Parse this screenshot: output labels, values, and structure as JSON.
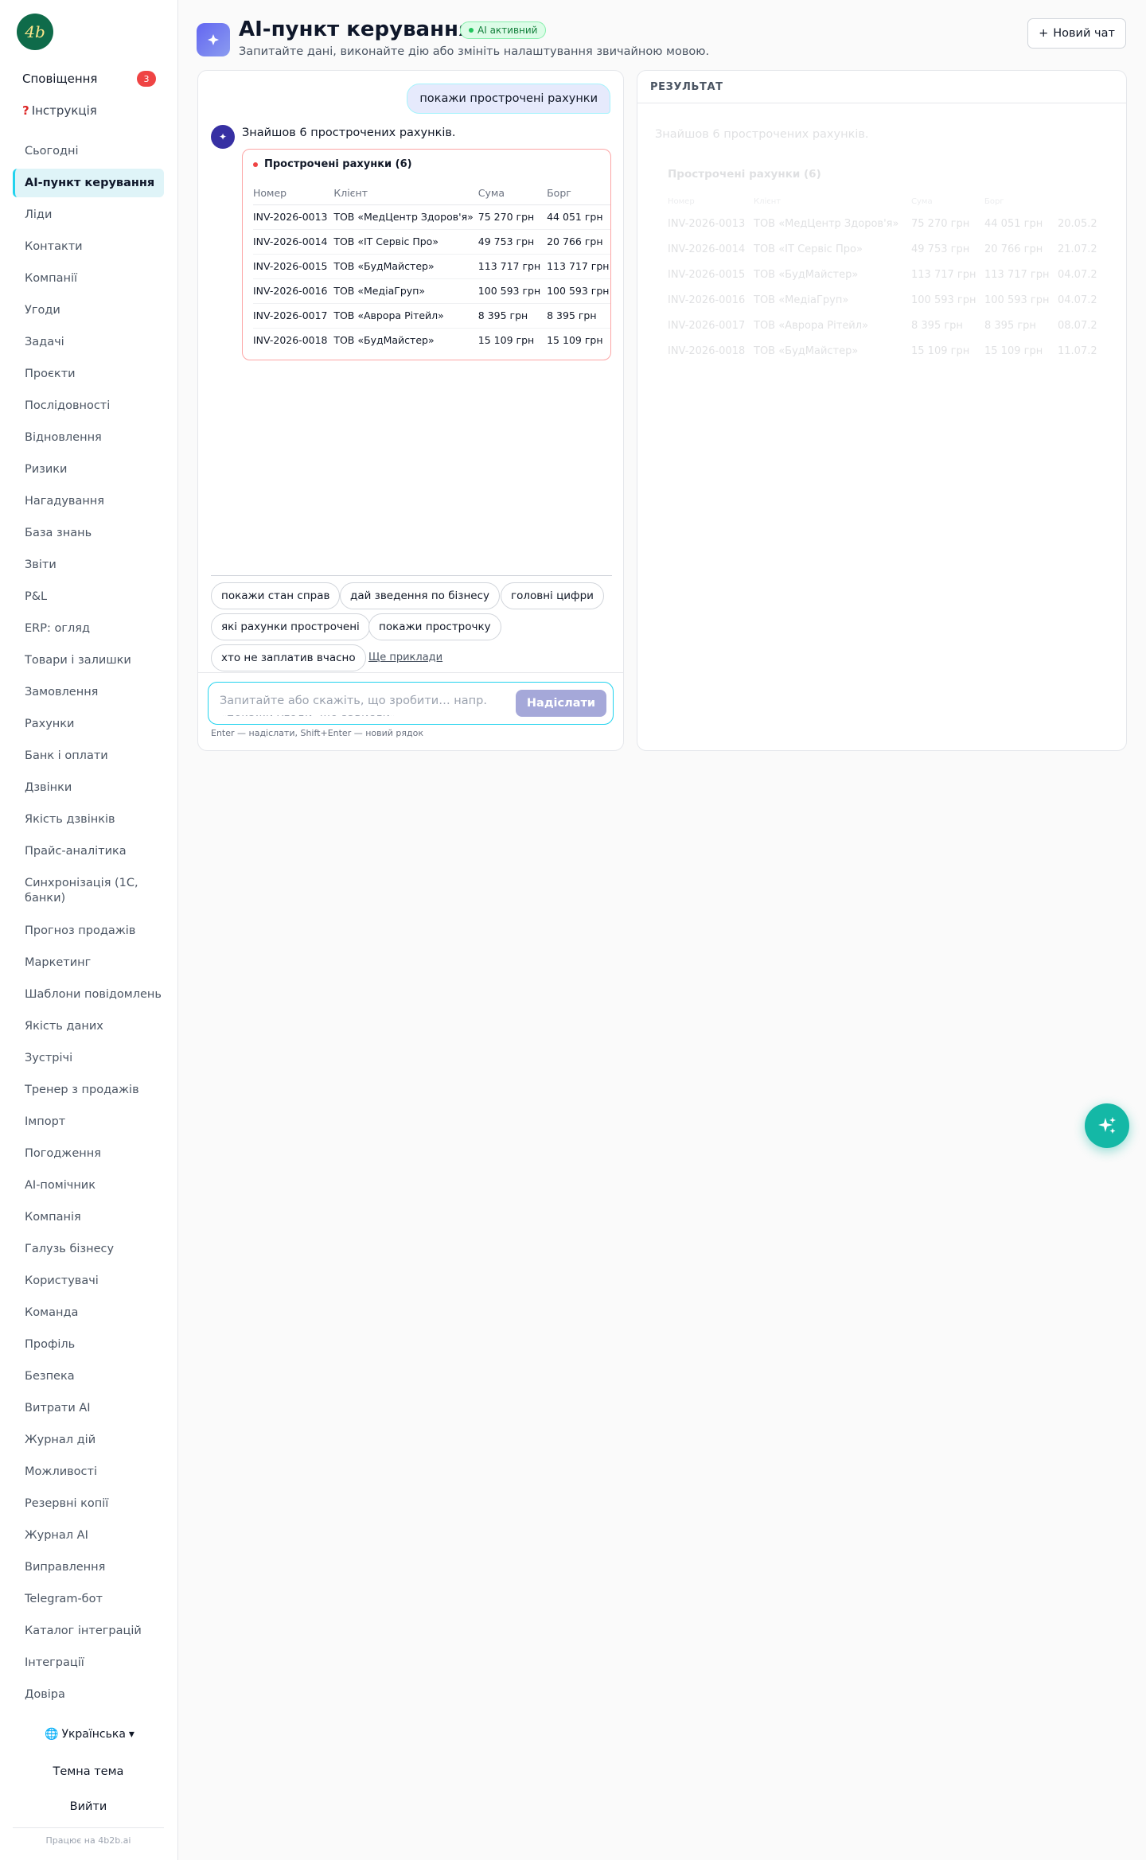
{
  "brand": {
    "logo_text": "4b"
  },
  "sidebar": {
    "notifications": {
      "label": "Сповіщення",
      "count": "3"
    },
    "guide": {
      "icon": "question-icon",
      "label": "Інструкція"
    },
    "items": [
      {
        "label": "Сьогодні"
      },
      {
        "label": "AI-пункт керування",
        "active": true
      },
      {
        "label": "Ліди"
      },
      {
        "label": "Контакти"
      },
      {
        "label": "Компанії"
      },
      {
        "label": "Угоди"
      },
      {
        "label": "Задачі"
      },
      {
        "label": "Проєкти"
      },
      {
        "label": "Послідовності"
      },
      {
        "label": "Відновлення"
      },
      {
        "label": "Ризики"
      },
      {
        "label": "Нагадування"
      },
      {
        "label": "База знань"
      },
      {
        "label": "Звіти"
      },
      {
        "label": "P&L"
      },
      {
        "label": "ERP: огляд"
      },
      {
        "label": "Товари і залишки"
      },
      {
        "label": "Замовлення"
      },
      {
        "label": "Рахунки"
      },
      {
        "label": "Банк і оплати"
      },
      {
        "label": "Дзвінки"
      },
      {
        "label": "Якість дзвінків"
      },
      {
        "label": "Прайс-аналітика"
      },
      {
        "label": "Синхронізація (1С, банки)"
      },
      {
        "label": "Прогноз продажів"
      },
      {
        "label": "Маркетинг"
      },
      {
        "label": "Шаблони повідомлень"
      },
      {
        "label": "Якість даних"
      },
      {
        "label": "Зустрічі"
      },
      {
        "label": "Тренер з продажів"
      },
      {
        "label": "Імпорт"
      },
      {
        "label": "Погодження"
      },
      {
        "label": "AI-помічник"
      },
      {
        "label": "Компанія"
      },
      {
        "label": "Галузь бізнесу"
      },
      {
        "label": "Користувачі"
      },
      {
        "label": "Команда"
      },
      {
        "label": "Профіль"
      },
      {
        "label": "Безпека"
      },
      {
        "label": "Витрати AI"
      },
      {
        "label": "Журнал дій"
      },
      {
        "label": "Можливості"
      },
      {
        "label": "Резервні копії"
      },
      {
        "label": "Журнал AI"
      },
      {
        "label": "Виправлення"
      },
      {
        "label": "Telegram-бот"
      },
      {
        "label": "Каталог інтеграцій"
      },
      {
        "label": "Інтеграції"
      },
      {
        "label": "Довіра"
      }
    ],
    "language": {
      "icon": "globe-icon",
      "label": "Українська"
    },
    "theme_label": "Темна тема",
    "logout_label": "Вийти",
    "powered_by": "Працює на 4b2b.ai"
  },
  "header": {
    "title": "AI-пункт керування",
    "status_badge": "AI активний",
    "subtitle": "Запитайте дані, виконайте дію або змініть налаштування звичайною мовою.",
    "new_chat_label": "Новий чат",
    "new_chat_icon": "plus-icon"
  },
  "chat": {
    "user_message": "покажи прострочені рахунки",
    "bot_text": "Знайшов 6 прострочених рахунків.",
    "card": {
      "title": "Прострочені рахунки (6)",
      "columns": [
        "Номер",
        "Клієнт",
        "Сума",
        "Борг"
      ],
      "rows": [
        [
          "INV-2026-0013",
          "ТОВ «МедЦентр Здоров'я»",
          "75 270 грн",
          "44 051 грн"
        ],
        [
          "INV-2026-0014",
          "ТОВ «ІТ Сервіс Про»",
          "49 753 грн",
          "20 766 грн"
        ],
        [
          "INV-2026-0015",
          "ТОВ «БудМайстер»",
          "113 717 грн",
          "113 717 грн"
        ],
        [
          "INV-2026-0016",
          "ТОВ «МедіаГруп»",
          "100 593 грн",
          "100 593 грн"
        ],
        [
          "INV-2026-0017",
          "ТОВ «Аврора Рітейл»",
          "8 395 грн",
          "8 395 грн"
        ],
        [
          "INV-2026-0018",
          "ТОВ «БудМайстер»",
          "15 109 грн",
          "15 109 грн"
        ]
      ]
    },
    "suggestions": [
      "покажи стан справ",
      "дай зведення по бізнесу",
      "головні цифри",
      "які рахунки прострочені",
      "покажи прострочку",
      "хто не заплатив вчасно"
    ],
    "more_examples": "Ще приклади",
    "input_placeholder": "Запитайте або скажіть, що зробити… напр. «покажи угоди, що зависли»",
    "send_label": "Надіслати",
    "hint": "Enter — надіслати, Shift+Enter — новий рядок"
  },
  "result": {
    "header": "РЕЗУЛЬТАТ",
    "ghost_text": "Знайшов 6 прострочених рахунків.",
    "ghost_title": "Прострочені рахунки (6)",
    "ghost_rows": [
      [
        "INV-2026-0013",
        "ТОВ «МедЦентр Здоров'я»",
        "75 270 грн",
        "44 051 грн",
        "20.05.2"
      ],
      [
        "INV-2026-0014",
        "ТОВ «ІТ Сервіс Про»",
        "49 753 грн",
        "20 766 грн",
        "21.07.2"
      ],
      [
        "INV-2026-0015",
        "ТОВ «БудМайстер»",
        "113 717 грн",
        "113 717 грн",
        "04.07.2"
      ],
      [
        "INV-2026-0016",
        "ТОВ «МедіаГруп»",
        "100 593 грн",
        "100 593 грн",
        "04.07.2"
      ],
      [
        "INV-2026-0017",
        "ТОВ «Аврора Рітейл»",
        "8 395 грн",
        "8 395 грн",
        "08.07.2"
      ],
      [
        "INV-2026-0018",
        "ТОВ «БудМайстер»",
        "15 109 грн",
        "15 109 грн",
        "11.07.2"
      ]
    ]
  },
  "fab": {
    "icon": "sparkles-icon"
  },
  "colors": {
    "accent": "#22d3ee",
    "brand": "#0f6b4a",
    "fab": "#14b8a6",
    "danger": "#ef4444",
    "send_button": "#a5a8d9"
  }
}
